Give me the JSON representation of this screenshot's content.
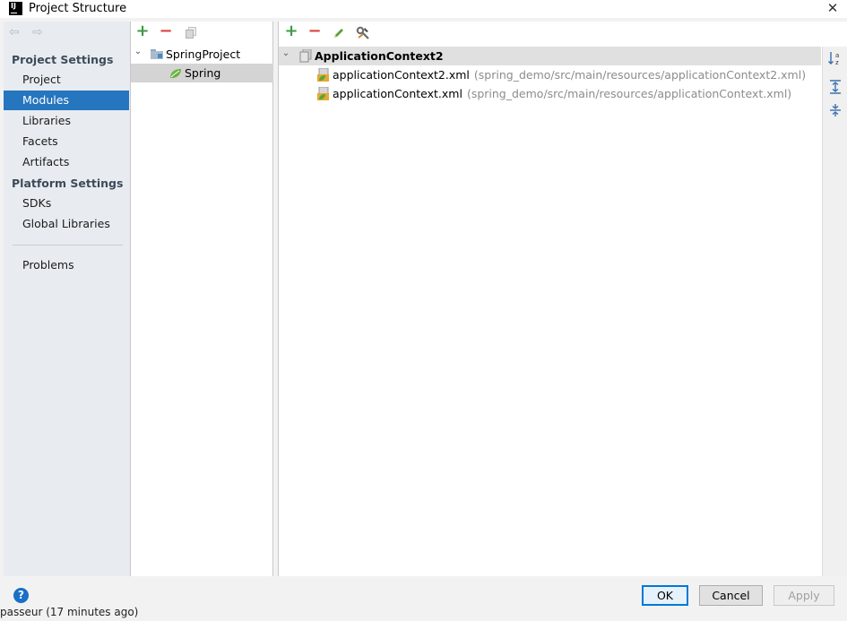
{
  "window": {
    "title": "Project Structure",
    "close_glyph": "✕",
    "app_icon_text": "IJ"
  },
  "nav": {
    "back_glyph": "⇦",
    "forward_glyph": "⇨",
    "project_settings_label": "Project Settings",
    "project_items": [
      {
        "label": "Project"
      },
      {
        "label": "Modules"
      },
      {
        "label": "Libraries"
      },
      {
        "label": "Facets"
      },
      {
        "label": "Artifacts"
      }
    ],
    "platform_settings_label": "Platform Settings",
    "platform_items": [
      {
        "label": "SDKs"
      },
      {
        "label": "Global Libraries"
      }
    ],
    "problems_label": "Problems",
    "selected": "Modules"
  },
  "tree": {
    "add_glyph": "+",
    "remove_glyph": "−",
    "rows": [
      {
        "label": "SpringProject",
        "expanded_glyph": "⌄"
      },
      {
        "label": "Spring"
      }
    ]
  },
  "fileset": {
    "add_glyph": "+",
    "remove_glyph": "−",
    "header_label": "ApplicationContext2",
    "expanded_glyph": "⌄",
    "files": [
      {
        "name": "applicationContext2.xml",
        "path": "(spring_demo/src/main/resources/applicationContext2.xml)"
      },
      {
        "name": "applicationContext.xml",
        "path": "(spring_demo/src/main/resources/applicationContext.xml)"
      }
    ]
  },
  "buttons": {
    "ok": "OK",
    "cancel": "Cancel",
    "apply": "Apply",
    "help": "?"
  },
  "background_text": "passeur    (17 minutes ago)",
  "colors": {
    "selection": "#2675bf",
    "add": "#3d9a43",
    "remove": "#d9403a",
    "path_gray": "#8c8c8c"
  }
}
